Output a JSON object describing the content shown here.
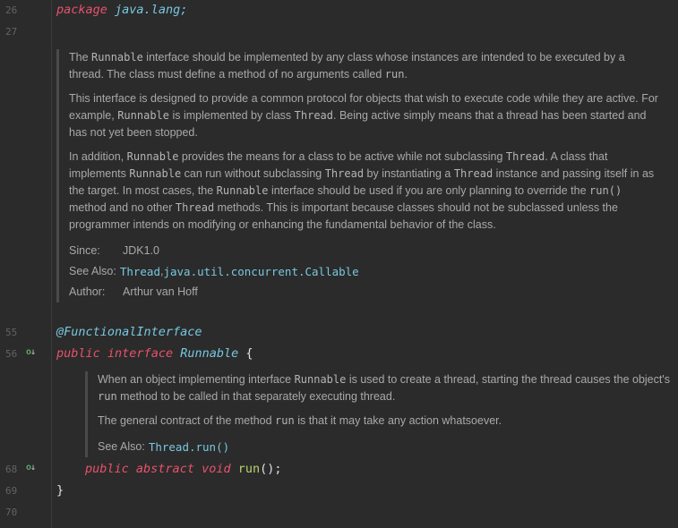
{
  "gutter": {
    "line_26": "26",
    "line_27": "27",
    "line_55": "55",
    "line_56": "56",
    "line_68": "68",
    "line_69": "69",
    "line_70": "70"
  },
  "code": {
    "package_kw": "package",
    "package_name": "java.lang;",
    "annotation": "@FunctionalInterface",
    "public_kw": "public",
    "interface_kw": "interface",
    "interface_name": "Runnable",
    "open_brace": "{",
    "method_public_kw": "public",
    "method_abstract_kw": "abstract",
    "method_void_kw": "void",
    "method_name": "run",
    "method_tail": "();",
    "close_brace": "}"
  },
  "class_doc": {
    "p1": {
      "t1": "The ",
      "c1": "Runnable",
      "t2": " interface should be implemented by any class whose instances are intended to be executed by a thread. The class must define a method of no arguments called ",
      "c2": "run",
      "t3": "."
    },
    "p2": {
      "t1": "This interface is designed to provide a common protocol for objects that wish to execute code while they are active. For example, ",
      "c1": "Runnable",
      "t2": " is implemented by class ",
      "c2": "Thread",
      "t3": ". Being active simply means that a thread has been started and has not yet been stopped."
    },
    "p3": {
      "t1": "In addition, ",
      "c1": "Runnable",
      "t2": " provides the means for a class to be active while not subclassing ",
      "c2": "Thread",
      "t3": ". A class that implements ",
      "c3": "Runnable",
      "t4": " can run without subclassing ",
      "c4": "Thread",
      "t5": " by instantiating a ",
      "c5": "Thread",
      "t6": " instance and passing itself in as the target. In most cases, the ",
      "c6": "Runnable",
      "t7": " interface should be used if you are only planning to override the ",
      "c7": "run()",
      "t8": " method and no other ",
      "c8": "Thread",
      "t9": " methods. This is important because classes should not be subclassed unless the programmer intends on modifying or enhancing the fundamental behavior of the class."
    },
    "since_label": "Since:",
    "since_value": "JDK1.0",
    "see_also_label": "See Also:",
    "see_also_link1": "Thread",
    "see_also_sep": ", ",
    "see_also_link2": "java.util.concurrent.Callable",
    "author_label": "Author:",
    "author_value": "Arthur van Hoff"
  },
  "method_doc": {
    "p1": {
      "t1": "When an object implementing interface ",
      "c1": "Runnable",
      "t2": " is used to create a thread, starting the thread causes the object's ",
      "c2": "run",
      "t3": " method to be called in that separately executing thread."
    },
    "p2": {
      "t1": "The general contract of the method ",
      "c1": "run",
      "t2": " is that it may take any action whatsoever."
    },
    "see_also_label": "See Also:",
    "see_also_link": "Thread.run()"
  },
  "icons": {
    "implemented_marker": "overrides-implemented-icon"
  }
}
